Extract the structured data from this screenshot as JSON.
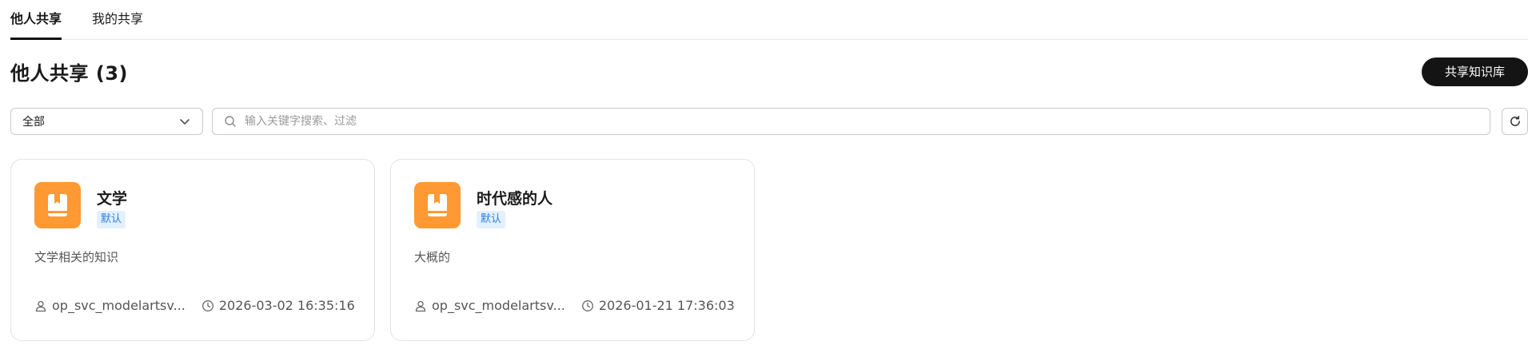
{
  "tabs": [
    {
      "label": "他人共享",
      "active": true
    },
    {
      "label": "我的共享",
      "active": false
    }
  ],
  "page_title": "他人共享 (3)",
  "share_button_label": "共享知识库",
  "filter": {
    "selected": "全部"
  },
  "search": {
    "placeholder": "输入关键字搜索、过滤",
    "value": ""
  },
  "cards": [
    {
      "name": "文学",
      "tag": "默认",
      "description": "文学相关的知识",
      "owner": "op_svc_modelartsv...",
      "time": "2026-03-02 16:35:16",
      "icon": "book-icon"
    },
    {
      "name": "时代感的人",
      "tag": "默认",
      "description": "大概的",
      "owner": "op_svc_modelartsv...",
      "time": "2026-01-21 17:36:03",
      "icon": "book-icon"
    }
  ],
  "colors": {
    "accent": "#141414",
    "icon_bg": "#ff9933",
    "tag_bg": "#e3f0ff",
    "tag_text": "#2d7de0"
  }
}
